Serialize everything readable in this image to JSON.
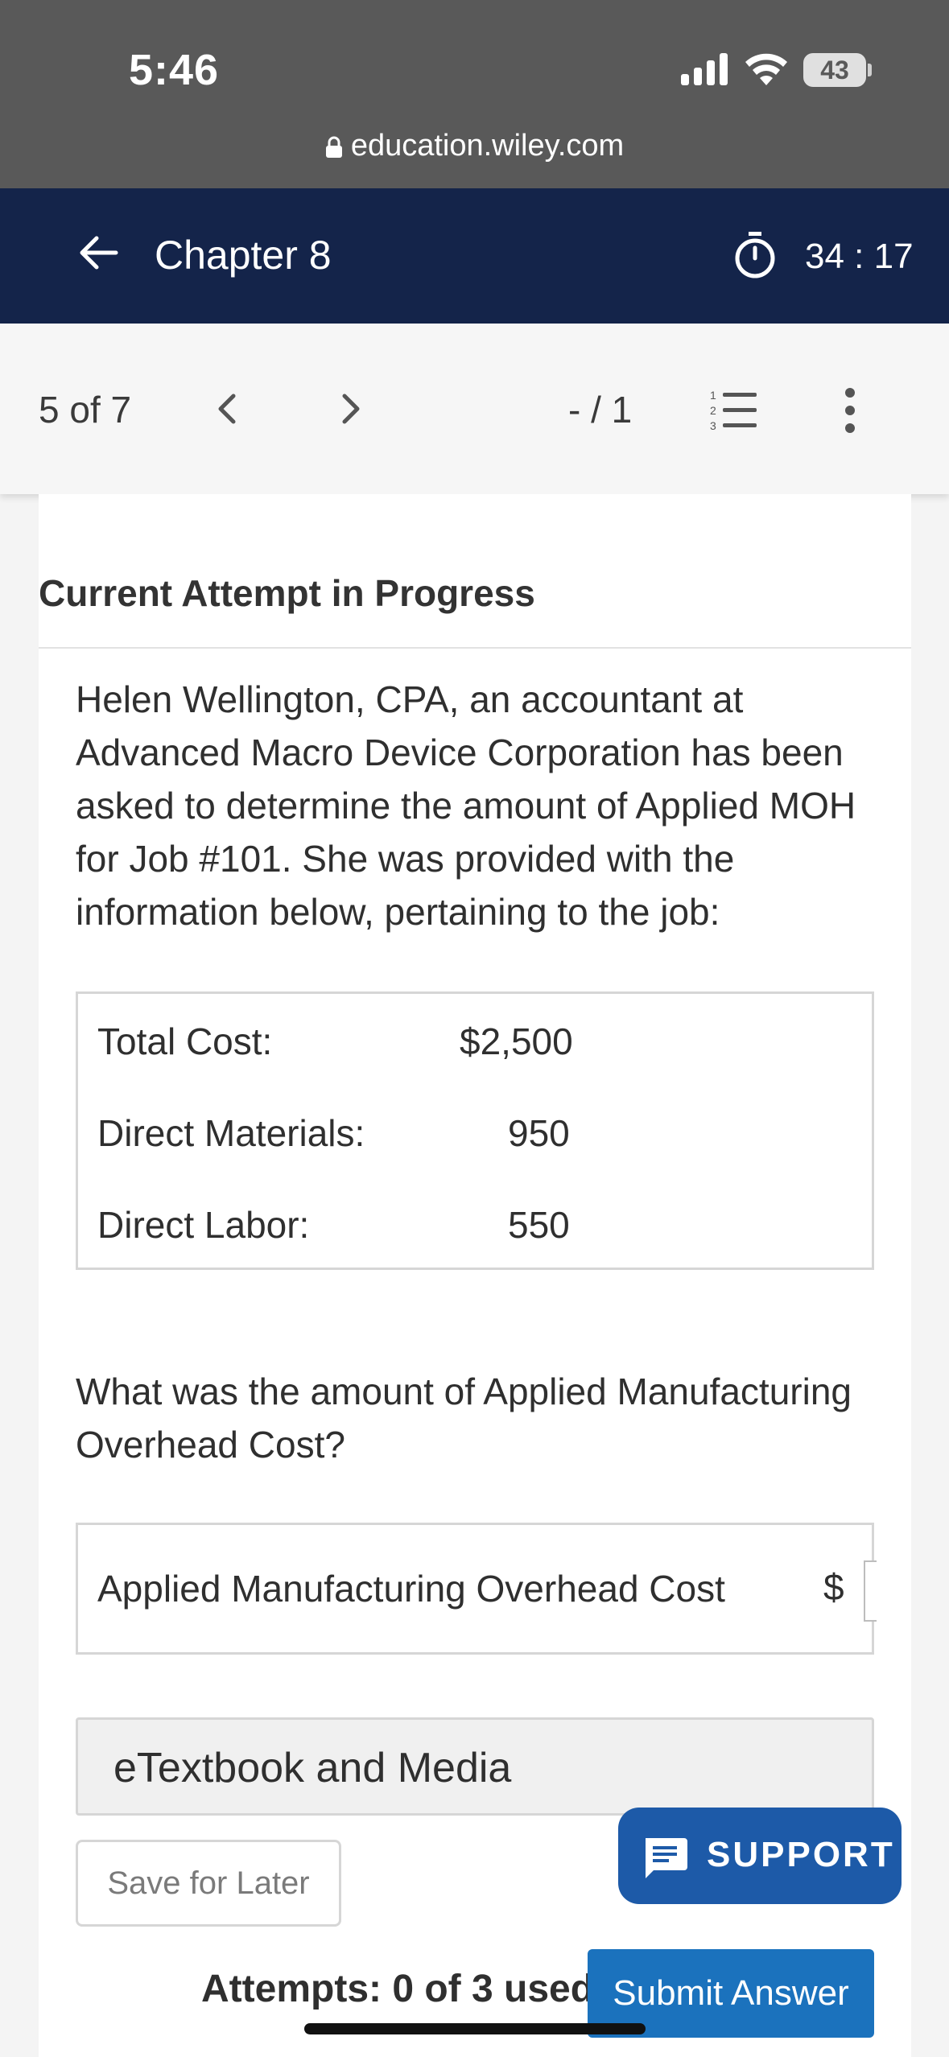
{
  "status_bar": {
    "time": "5:46",
    "battery": "43",
    "url": "education.wiley.com"
  },
  "header": {
    "title": "Chapter 8",
    "timer": "34 : 17",
    "icons": {
      "back": "arrow-left-icon",
      "timer": "stopwatch-icon"
    }
  },
  "toolbar": {
    "page_count": "5 of 7",
    "score": "- / 1",
    "icons": {
      "prev": "chevron-left-icon",
      "next": "chevron-right-icon",
      "list": "numbered-list-icon",
      "more": "more-vertical-icon"
    }
  },
  "question": {
    "heading": "Current Attempt in Progress",
    "text": "Helen Wellington, CPA, an accountant at Advanced Macro Device Corporation has been asked to determine the amount of Applied MOH for Job #101. She was provided with the information below, pertaining to the job:",
    "table": [
      {
        "label": "Total Cost:",
        "value": "$2,500"
      },
      {
        "label": "Direct Materials:",
        "value": "950"
      },
      {
        "label": "Direct Labor:",
        "value": "550"
      }
    ],
    "prompt": "What was the amount of Applied Manufacturing Overhead Cost?"
  },
  "answer": {
    "label": "Applied Manufacturing Overhead Cost",
    "currency": "$",
    "value": ""
  },
  "etextbook": {
    "label": "eTextbook and Media"
  },
  "actions": {
    "save_label": "Save for Later",
    "support_label": "SUPPORT",
    "attempts": "Attempts: 0 of 3 used",
    "submit_label": "Submit Answer"
  },
  "colors": {
    "header_bg": "#14244a",
    "status_bg": "#595959",
    "support_bg": "#1d5aa8",
    "submit_bg": "#1b72bd"
  }
}
